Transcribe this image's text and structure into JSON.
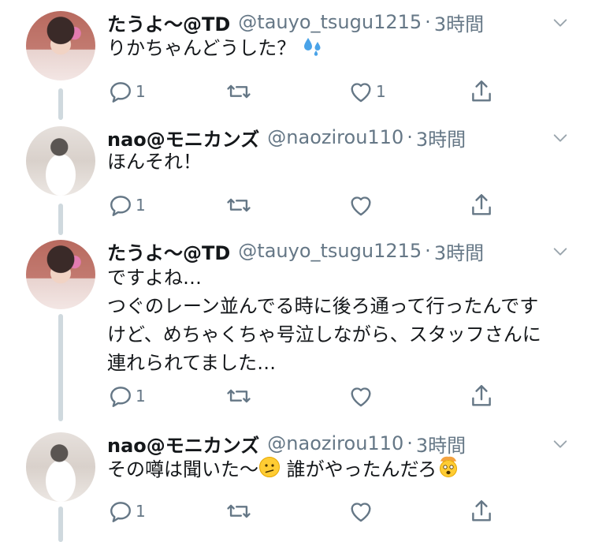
{
  "tweets": [
    {
      "name": "たうよ〜@TD",
      "handle": "@tauyo_tsugu1215",
      "separator": "·",
      "time": "3時間",
      "text": "りかちゃんどうした？",
      "text_emoji": "sweat-droplets-emoji",
      "reply_count": "1",
      "like_count": "1"
    },
    {
      "name": "nao@モニカンズ",
      "handle": "@naozirou110",
      "separator": "·",
      "time": "3時間",
      "text": "ほんそれ！",
      "reply_count": "1",
      "like_count": ""
    },
    {
      "name": "たうよ〜@TD",
      "handle": "@tauyo_tsugu1215",
      "separator": "·",
      "time": "3時間",
      "text": "ですよね…\nつぐのレーン並んでる時に後ろ通って行ったんです\nけど、めちゃくちゃ号泣しながら、スタッフさんに\n連れられてました…",
      "reply_count": "1",
      "like_count": ""
    },
    {
      "name": "nao@モニカンズ",
      "handle": "@naozirou110",
      "separator": "·",
      "time": "3時間",
      "text_part1": "その噂は聞いた〜",
      "text_part2": "誰がやったんだろ",
      "emoji_1": "confused-face-emoji",
      "emoji_2": "exploding-head-emoji",
      "reply_count": "1",
      "like_count": ""
    }
  ],
  "colors": {
    "text": "#14171a",
    "secondary": "#657786",
    "thread_line": "#cfd9de"
  }
}
